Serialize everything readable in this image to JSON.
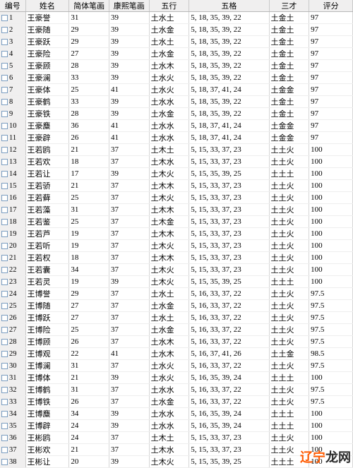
{
  "columns": {
    "idx": "编号",
    "name": "姓名",
    "sb": "简体笔画",
    "kb": "康熙笔画",
    "wx": "五行",
    "wg": "五格",
    "sc": "三才",
    "pf": "评分"
  },
  "rows": [
    {
      "idx": "1",
      "name": "王豪誉",
      "sb": "31",
      "kb": "39",
      "wx": "土水土",
      "wg": "5, 18, 35, 39, 22",
      "sc": "土金土",
      "pf": "97"
    },
    {
      "idx": "2",
      "name": "王豪随",
      "sb": "29",
      "kb": "39",
      "wx": "土水金",
      "wg": "5, 18, 35, 39, 22",
      "sc": "土金土",
      "pf": "97"
    },
    {
      "idx": "3",
      "name": "王豪跃",
      "sb": "29",
      "kb": "39",
      "wx": "土水土",
      "wg": "5, 18, 35, 39, 22",
      "sc": "土金土",
      "pf": "97"
    },
    {
      "idx": "4",
      "name": "王豪险",
      "sb": "27",
      "kb": "39",
      "wx": "土水金",
      "wg": "5, 18, 35, 39, 22",
      "sc": "土金土",
      "pf": "97"
    },
    {
      "idx": "5",
      "name": "王豪顾",
      "sb": "28",
      "kb": "39",
      "wx": "土水木",
      "wg": "5, 18, 35, 39, 22",
      "sc": "土金土",
      "pf": "97"
    },
    {
      "idx": "6",
      "name": "王豪澜",
      "sb": "33",
      "kb": "39",
      "wx": "土水火",
      "wg": "5, 18, 35, 39, 22",
      "sc": "土金土",
      "pf": "97"
    },
    {
      "idx": "7",
      "name": "王豪体",
      "sb": "25",
      "kb": "41",
      "wx": "土水火",
      "wg": "5, 18, 37, 41, 24",
      "sc": "土金金",
      "pf": "97"
    },
    {
      "idx": "8",
      "name": "王豪鹤",
      "sb": "33",
      "kb": "39",
      "wx": "土水水",
      "wg": "5, 18, 35, 39, 22",
      "sc": "土金土",
      "pf": "97"
    },
    {
      "idx": "9",
      "name": "王豪铁",
      "sb": "28",
      "kb": "39",
      "wx": "土水金",
      "wg": "5, 18, 35, 39, 22",
      "sc": "土金土",
      "pf": "97"
    },
    {
      "idx": "10",
      "name": "王豪麋",
      "sb": "36",
      "kb": "41",
      "wx": "土水水",
      "wg": "5, 18, 37, 41, 24",
      "sc": "土金金",
      "pf": "97"
    },
    {
      "idx": "11",
      "name": "王豪辟",
      "sb": "26",
      "kb": "41",
      "wx": "土水水",
      "wg": "5, 18, 37, 41, 24",
      "sc": "土金金",
      "pf": "97"
    },
    {
      "idx": "12",
      "name": "王若鸥",
      "sb": "21",
      "kb": "37",
      "wx": "土木土",
      "wg": "5, 15, 33, 37, 23",
      "sc": "土土火",
      "pf": "100"
    },
    {
      "idx": "13",
      "name": "王若欢",
      "sb": "18",
      "kb": "37",
      "wx": "土木水",
      "wg": "5, 15, 33, 37, 23",
      "sc": "土土火",
      "pf": "100"
    },
    {
      "idx": "14",
      "name": "王若让",
      "sb": "17",
      "kb": "39",
      "wx": "土木火",
      "wg": "5, 15, 35, 39, 25",
      "sc": "土土土",
      "pf": "100"
    },
    {
      "idx": "15",
      "name": "王若骄",
      "sb": "21",
      "kb": "37",
      "wx": "土木木",
      "wg": "5, 15, 33, 37, 23",
      "sc": "土土火",
      "pf": "100"
    },
    {
      "idx": "16",
      "name": "王若藓",
      "sb": "25",
      "kb": "37",
      "wx": "土木火",
      "wg": "5, 15, 33, 37, 23",
      "sc": "土土火",
      "pf": "100"
    },
    {
      "idx": "17",
      "name": "王若藻",
      "sb": "31",
      "kb": "37",
      "wx": "土木木",
      "wg": "5, 15, 33, 37, 23",
      "sc": "土土火",
      "pf": "100"
    },
    {
      "idx": "18",
      "name": "王若鉴",
      "sb": "25",
      "kb": "37",
      "wx": "土木金",
      "wg": "5, 15, 33, 37, 23",
      "sc": "土土火",
      "pf": "100"
    },
    {
      "idx": "19",
      "name": "王若芦",
      "sb": "19",
      "kb": "37",
      "wx": "土木木",
      "wg": "5, 15, 33, 37, 23",
      "sc": "土土火",
      "pf": "100"
    },
    {
      "idx": "20",
      "name": "王若听",
      "sb": "19",
      "kb": "37",
      "wx": "土木火",
      "wg": "5, 15, 33, 37, 23",
      "sc": "土土火",
      "pf": "100"
    },
    {
      "idx": "21",
      "name": "王若权",
      "sb": "18",
      "kb": "37",
      "wx": "土木木",
      "wg": "5, 15, 33, 37, 23",
      "sc": "土土火",
      "pf": "100"
    },
    {
      "idx": "22",
      "name": "王若囊",
      "sb": "34",
      "kb": "37",
      "wx": "土木火",
      "wg": "5, 15, 33, 37, 23",
      "sc": "土土火",
      "pf": "100"
    },
    {
      "idx": "23",
      "name": "王若灵",
      "sb": "19",
      "kb": "39",
      "wx": "土木火",
      "wg": "5, 15, 35, 39, 25",
      "sc": "土土土",
      "pf": "100"
    },
    {
      "idx": "24",
      "name": "王博誉",
      "sb": "29",
      "kb": "37",
      "wx": "土水土",
      "wg": "5, 16, 33, 37, 22",
      "sc": "土土火",
      "pf": "97.5"
    },
    {
      "idx": "25",
      "name": "王博随",
      "sb": "27",
      "kb": "37",
      "wx": "土水金",
      "wg": "5, 16, 33, 37, 22",
      "sc": "土土火",
      "pf": "97.5"
    },
    {
      "idx": "26",
      "name": "王博跃",
      "sb": "27",
      "kb": "37",
      "wx": "土水土",
      "wg": "5, 16, 33, 37, 22",
      "sc": "土土火",
      "pf": "97.5"
    },
    {
      "idx": "27",
      "name": "王博险",
      "sb": "25",
      "kb": "37",
      "wx": "土水金",
      "wg": "5, 16, 33, 37, 22",
      "sc": "土土火",
      "pf": "97.5"
    },
    {
      "idx": "28",
      "name": "王博顾",
      "sb": "26",
      "kb": "37",
      "wx": "土水木",
      "wg": "5, 16, 33, 37, 22",
      "sc": "土土火",
      "pf": "97.5"
    },
    {
      "idx": "29",
      "name": "王博观",
      "sb": "22",
      "kb": "41",
      "wx": "土水木",
      "wg": "5, 16, 37, 41, 26",
      "sc": "土土金",
      "pf": "98.5"
    },
    {
      "idx": "30",
      "name": "王博澜",
      "sb": "31",
      "kb": "37",
      "wx": "土水火",
      "wg": "5, 16, 33, 37, 22",
      "sc": "土土火",
      "pf": "97.5"
    },
    {
      "idx": "31",
      "name": "王博体",
      "sb": "21",
      "kb": "39",
      "wx": "土水火",
      "wg": "5, 16, 35, 39, 24",
      "sc": "土土土",
      "pf": "100"
    },
    {
      "idx": "32",
      "name": "王博鹤",
      "sb": "31",
      "kb": "37",
      "wx": "土水水",
      "wg": "5, 16, 33, 37, 22",
      "sc": "土土火",
      "pf": "97.5"
    },
    {
      "idx": "33",
      "name": "王博铁",
      "sb": "26",
      "kb": "37",
      "wx": "土水金",
      "wg": "5, 16, 33, 37, 22",
      "sc": "土土火",
      "pf": "97.5"
    },
    {
      "idx": "34",
      "name": "王博麋",
      "sb": "34",
      "kb": "39",
      "wx": "土水水",
      "wg": "5, 16, 35, 39, 24",
      "sc": "土土土",
      "pf": "100"
    },
    {
      "idx": "35",
      "name": "王博辟",
      "sb": "24",
      "kb": "39",
      "wx": "土水水",
      "wg": "5, 16, 35, 39, 24",
      "sc": "土土土",
      "pf": "100"
    },
    {
      "idx": "36",
      "name": "王彬鸥",
      "sb": "24",
      "kb": "37",
      "wx": "土木土",
      "wg": "5, 15, 33, 37, 23",
      "sc": "土土火",
      "pf": "100"
    },
    {
      "idx": "37",
      "name": "王彬欢",
      "sb": "21",
      "kb": "37",
      "wx": "土木水",
      "wg": "5, 15, 33, 37, 23",
      "sc": "土土火",
      "pf": "100"
    },
    {
      "idx": "38",
      "name": "王彬让",
      "sb": "20",
      "kb": "39",
      "wx": "土木火",
      "wg": "5, 15, 35, 39, 25",
      "sc": "土土土",
      "pf": "100"
    }
  ],
  "watermark": {
    "part1": "辽宁",
    "part2": "龙网"
  }
}
